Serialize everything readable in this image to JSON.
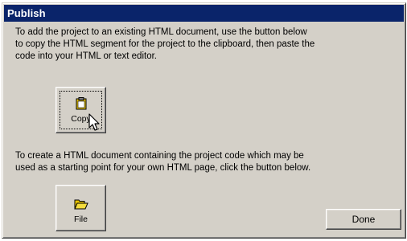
{
  "dialog": {
    "title": "Publish",
    "text_copy": "To add the project to an existing HTML document, use the button below\nto copy the HTML segment for the project to the clipboard, then paste the\ncode into your HTML or text editor.",
    "text_file": "To create a HTML document containing the project code which may be\nused as a starting point for your own HTML page, click the button below."
  },
  "buttons": {
    "copy_label": "Copy",
    "copy_icon": "clipboard-icon",
    "file_label": "File",
    "file_icon": "open-folder-icon",
    "done_label": "Done"
  },
  "colors": {
    "titlebar": "#0a246a",
    "face": "#d4d0c8",
    "icon_yellow": "#e8c400"
  }
}
